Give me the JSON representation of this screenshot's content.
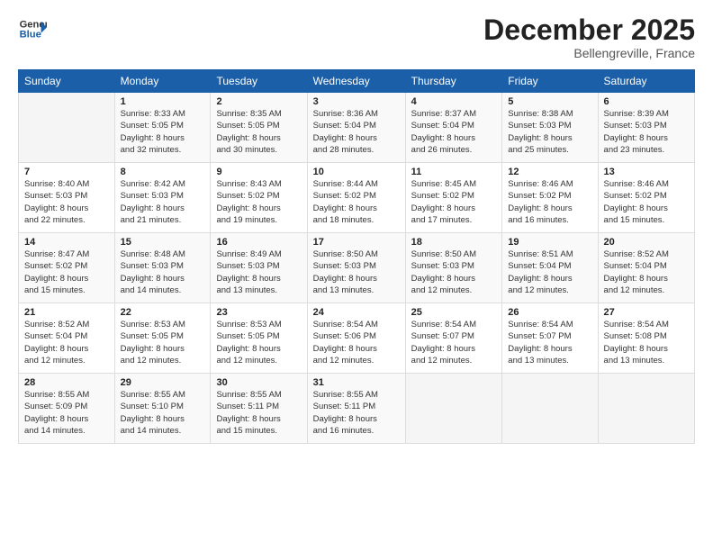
{
  "header": {
    "logo_line1": "General",
    "logo_line2": "Blue",
    "month": "December 2025",
    "location": "Bellengreville, France"
  },
  "weekdays": [
    "Sunday",
    "Monday",
    "Tuesday",
    "Wednesday",
    "Thursday",
    "Friday",
    "Saturday"
  ],
  "weeks": [
    [
      {
        "day": "",
        "info": ""
      },
      {
        "day": "1",
        "info": "Sunrise: 8:33 AM\nSunset: 5:05 PM\nDaylight: 8 hours\nand 32 minutes."
      },
      {
        "day": "2",
        "info": "Sunrise: 8:35 AM\nSunset: 5:05 PM\nDaylight: 8 hours\nand 30 minutes."
      },
      {
        "day": "3",
        "info": "Sunrise: 8:36 AM\nSunset: 5:04 PM\nDaylight: 8 hours\nand 28 minutes."
      },
      {
        "day": "4",
        "info": "Sunrise: 8:37 AM\nSunset: 5:04 PM\nDaylight: 8 hours\nand 26 minutes."
      },
      {
        "day": "5",
        "info": "Sunrise: 8:38 AM\nSunset: 5:03 PM\nDaylight: 8 hours\nand 25 minutes."
      },
      {
        "day": "6",
        "info": "Sunrise: 8:39 AM\nSunset: 5:03 PM\nDaylight: 8 hours\nand 23 minutes."
      }
    ],
    [
      {
        "day": "7",
        "info": "Sunrise: 8:40 AM\nSunset: 5:03 PM\nDaylight: 8 hours\nand 22 minutes."
      },
      {
        "day": "8",
        "info": "Sunrise: 8:42 AM\nSunset: 5:03 PM\nDaylight: 8 hours\nand 21 minutes."
      },
      {
        "day": "9",
        "info": "Sunrise: 8:43 AM\nSunset: 5:02 PM\nDaylight: 8 hours\nand 19 minutes."
      },
      {
        "day": "10",
        "info": "Sunrise: 8:44 AM\nSunset: 5:02 PM\nDaylight: 8 hours\nand 18 minutes."
      },
      {
        "day": "11",
        "info": "Sunrise: 8:45 AM\nSunset: 5:02 PM\nDaylight: 8 hours\nand 17 minutes."
      },
      {
        "day": "12",
        "info": "Sunrise: 8:46 AM\nSunset: 5:02 PM\nDaylight: 8 hours\nand 16 minutes."
      },
      {
        "day": "13",
        "info": "Sunrise: 8:46 AM\nSunset: 5:02 PM\nDaylight: 8 hours\nand 15 minutes."
      }
    ],
    [
      {
        "day": "14",
        "info": "Sunrise: 8:47 AM\nSunset: 5:02 PM\nDaylight: 8 hours\nand 15 minutes."
      },
      {
        "day": "15",
        "info": "Sunrise: 8:48 AM\nSunset: 5:03 PM\nDaylight: 8 hours\nand 14 minutes."
      },
      {
        "day": "16",
        "info": "Sunrise: 8:49 AM\nSunset: 5:03 PM\nDaylight: 8 hours\nand 13 minutes."
      },
      {
        "day": "17",
        "info": "Sunrise: 8:50 AM\nSunset: 5:03 PM\nDaylight: 8 hours\nand 13 minutes."
      },
      {
        "day": "18",
        "info": "Sunrise: 8:50 AM\nSunset: 5:03 PM\nDaylight: 8 hours\nand 12 minutes."
      },
      {
        "day": "19",
        "info": "Sunrise: 8:51 AM\nSunset: 5:04 PM\nDaylight: 8 hours\nand 12 minutes."
      },
      {
        "day": "20",
        "info": "Sunrise: 8:52 AM\nSunset: 5:04 PM\nDaylight: 8 hours\nand 12 minutes."
      }
    ],
    [
      {
        "day": "21",
        "info": "Sunrise: 8:52 AM\nSunset: 5:04 PM\nDaylight: 8 hours\nand 12 minutes."
      },
      {
        "day": "22",
        "info": "Sunrise: 8:53 AM\nSunset: 5:05 PM\nDaylight: 8 hours\nand 12 minutes."
      },
      {
        "day": "23",
        "info": "Sunrise: 8:53 AM\nSunset: 5:05 PM\nDaylight: 8 hours\nand 12 minutes."
      },
      {
        "day": "24",
        "info": "Sunrise: 8:54 AM\nSunset: 5:06 PM\nDaylight: 8 hours\nand 12 minutes."
      },
      {
        "day": "25",
        "info": "Sunrise: 8:54 AM\nSunset: 5:07 PM\nDaylight: 8 hours\nand 12 minutes."
      },
      {
        "day": "26",
        "info": "Sunrise: 8:54 AM\nSunset: 5:07 PM\nDaylight: 8 hours\nand 13 minutes."
      },
      {
        "day": "27",
        "info": "Sunrise: 8:54 AM\nSunset: 5:08 PM\nDaylight: 8 hours\nand 13 minutes."
      }
    ],
    [
      {
        "day": "28",
        "info": "Sunrise: 8:55 AM\nSunset: 5:09 PM\nDaylight: 8 hours\nand 14 minutes."
      },
      {
        "day": "29",
        "info": "Sunrise: 8:55 AM\nSunset: 5:10 PM\nDaylight: 8 hours\nand 14 minutes."
      },
      {
        "day": "30",
        "info": "Sunrise: 8:55 AM\nSunset: 5:11 PM\nDaylight: 8 hours\nand 15 minutes."
      },
      {
        "day": "31",
        "info": "Sunrise: 8:55 AM\nSunset: 5:11 PM\nDaylight: 8 hours\nand 16 minutes."
      },
      {
        "day": "",
        "info": ""
      },
      {
        "day": "",
        "info": ""
      },
      {
        "day": "",
        "info": ""
      }
    ]
  ]
}
